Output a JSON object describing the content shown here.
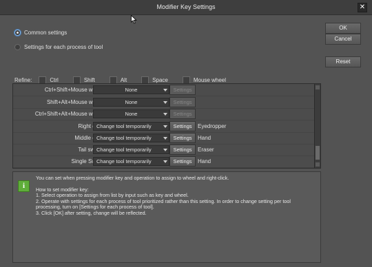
{
  "window": {
    "title": "Modifier Key Settings",
    "close_glyph": "✕"
  },
  "scope": {
    "options": [
      {
        "label": "Common settings",
        "selected": true
      },
      {
        "label": "Settings for each process of tool",
        "selected": false
      }
    ]
  },
  "buttons": {
    "ok": "OK",
    "cancel": "Cancel",
    "reset": "Reset"
  },
  "refine": {
    "label": "Refine:",
    "items": [
      {
        "label": "Ctrl",
        "checked": false
      },
      {
        "label": "Shift",
        "checked": false
      },
      {
        "label": "Alt",
        "checked": false
      },
      {
        "label": "Space",
        "checked": false
      },
      {
        "label": "Mouse wheel",
        "checked": false
      }
    ]
  },
  "rows": [
    {
      "input": "Ctrl+Shift+Mouse wheel:",
      "operation": "None",
      "settings": "Settings",
      "settings_enabled": false,
      "tool": ""
    },
    {
      "input": "Shift+Alt+Mouse wheel:",
      "operation": "None",
      "settings": "Settings",
      "settings_enabled": false,
      "tool": ""
    },
    {
      "input": "Ctrl+Shift+Alt+Mouse wheel:",
      "operation": "None",
      "settings": "Settings",
      "settings_enabled": false,
      "tool": ""
    },
    {
      "input": "Right click:",
      "operation": "Change tool temporarily",
      "settings": "Settings",
      "settings_enabled": true,
      "tool": "Eyedropper"
    },
    {
      "input": "Middle click:",
      "operation": "Change tool temporarily",
      "settings": "Settings",
      "settings_enabled": true,
      "tool": "Hand"
    },
    {
      "input": "Tail switch:",
      "operation": "Change tool temporarily",
      "settings": "Settings",
      "settings_enabled": true,
      "tool": "Eraser"
    },
    {
      "input": "Single Swipe:",
      "operation": "Change tool temporarily",
      "settings": "Settings",
      "settings_enabled": true,
      "tool": "Hand"
    }
  ],
  "info": {
    "icon": "info-icon",
    "intro": "You can set when pressing modifier key and operation to assign to wheel and right-click.",
    "howto_title": "How to set modifier key:",
    "step1": "1. Select operation to assign from list by input such as key and wheel.",
    "step2": "2. Operate with settings for each process of tool prioritized rather than this setting. In order to change setting per tool processing, turn on [Settings for each process of tool].",
    "step3": "3. Click [OK] after setting, change will be reflected."
  },
  "colors": {
    "accent_radio": "#4e7fb5",
    "info_icon": "#5fae3a"
  }
}
